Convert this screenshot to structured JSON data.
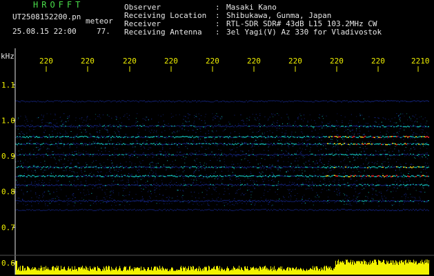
{
  "header": {
    "logo": "HROFFT",
    "filename": "UT2508152200.pn",
    "meteor_label": "meteor",
    "datetime": "25.08.15 22:00",
    "level": "77.",
    "meta": [
      {
        "key": "Observer",
        "value": "Masaki Kano"
      },
      {
        "key": "Receiving Location",
        "value": "Shibukawa, Gunma, Japan"
      },
      {
        "key": "Receiver",
        "value": "RTL-SDR SDR# 43dB L15 103.2MHz CW"
      },
      {
        "key": "Receiving Antenna",
        "value": "3el Yagi(V) Az 330 for Vladivostok"
      }
    ],
    "separator": ":"
  },
  "chart_data": {
    "type": "heatmap",
    "xlabel": "",
    "ylabel": "kHz",
    "x_tick_labels": [
      "220",
      "220",
      "220",
      "220",
      "220",
      "220",
      "220",
      "220",
      "220",
      "2210"
    ],
    "y_ticks": [
      1.1,
      1.0,
      0.9,
      0.8,
      0.7,
      0.6
    ],
    "ylim": [
      0.6,
      1.15
    ],
    "grid": false,
    "colors": {
      "background": "#000000",
      "noise": "#1a2fa8",
      "signal": "#16e0d8",
      "strong": "#ffe61a",
      "peak": "#ff2a2a",
      "bar": "#f2f200",
      "tick": "#f2f200"
    },
    "bands": [
      {
        "freq": 1.055,
        "intensity": 0.35
      },
      {
        "freq": 0.985,
        "intensity": 0.55
      },
      {
        "freq": 0.955,
        "intensity": 0.85
      },
      {
        "freq": 0.935,
        "intensity": 0.75
      },
      {
        "freq": 0.905,
        "intensity": 0.55
      },
      {
        "freq": 0.87,
        "intensity": 0.7
      },
      {
        "freq": 0.845,
        "intensity": 0.85
      },
      {
        "freq": 0.82,
        "intensity": 0.55
      },
      {
        "freq": 0.775,
        "intensity": 0.45
      },
      {
        "freq": 0.75,
        "intensity": 0.3
      }
    ],
    "bottom_bar_level": 0.6
  }
}
